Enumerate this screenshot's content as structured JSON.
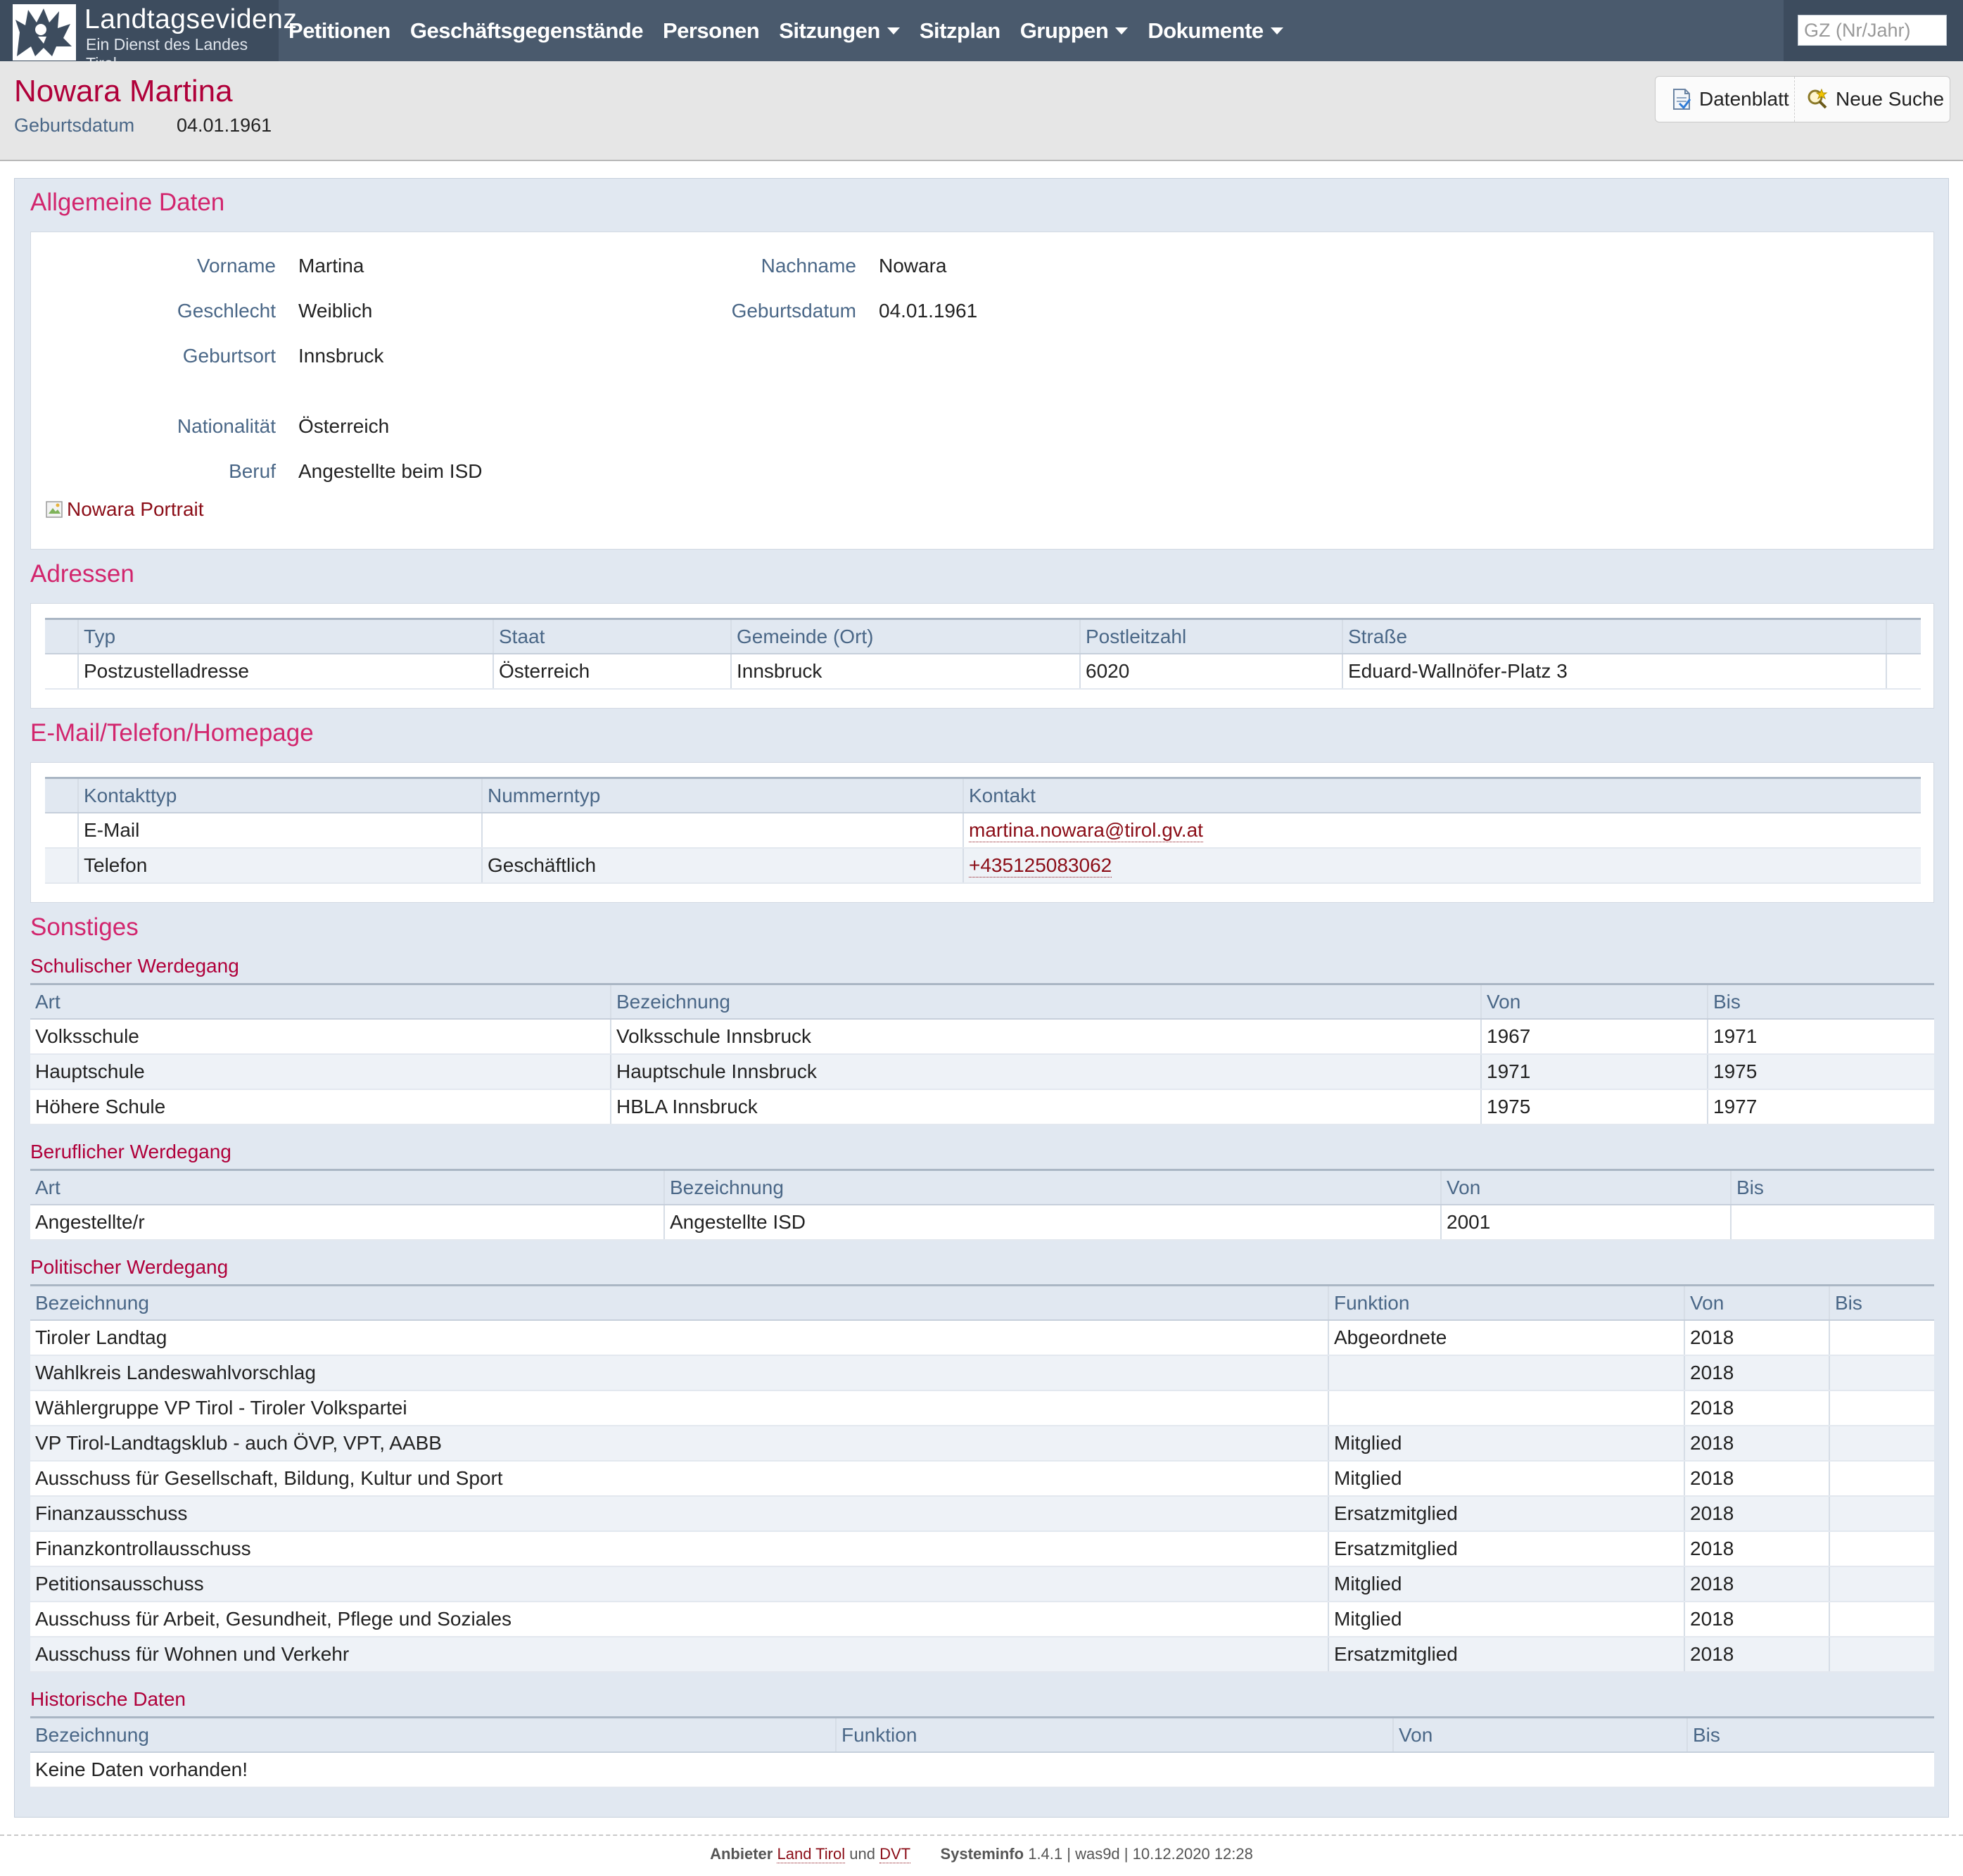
{
  "brand": {
    "title": "Landtagsevidenz",
    "subtitle": "Ein Dienst des Landes Tirol"
  },
  "nav": {
    "items": [
      "Petitionen",
      "Geschäftsgegenstände",
      "Personen",
      "Sitzungen",
      "Sitzplan",
      "Gruppen",
      "Dokumente"
    ],
    "dropdowns": [
      "Sitzungen",
      "Gruppen",
      "Dokumente"
    ],
    "search_placeholder": "GZ (Nr/Jahr)"
  },
  "header": {
    "name": "Nowara Martina",
    "birth_label": "Geburtsdatum",
    "birth_value": "04.01.1961",
    "buttons": {
      "datenblatt": "Datenblatt",
      "neue_suche": "Neue Suche"
    }
  },
  "allgemein": {
    "title": "Allgemeine Daten",
    "vorname_label": "Vorname",
    "vorname": "Martina",
    "nachname_label": "Nachname",
    "nachname": "Nowara",
    "geschlecht_label": "Geschlecht",
    "geschlecht": "Weiblich",
    "geburtsdatum_label": "Geburtsdatum",
    "geburtsdatum": "04.01.1961",
    "geburtsort_label": "Geburtsort",
    "geburtsort": "Innsbruck",
    "nationalitaet_label": "Nationalität",
    "nationalitaet": "Österreich",
    "beruf_label": "Beruf",
    "beruf": "Angestellte beim ISD",
    "portrait_alt": "Nowara Portrait"
  },
  "adressen": {
    "title": "Adressen",
    "headers": [
      "Typ",
      "Staat",
      "Gemeinde (Ort)",
      "Postleitzahl",
      "Straße"
    ],
    "rows": [
      [
        "Postzustelladresse",
        "Österreich",
        "Innsbruck",
        "6020",
        "Eduard-Wallnöfer-Platz 3"
      ]
    ]
  },
  "kontakt": {
    "title": "E-Mail/Telefon/Homepage",
    "headers": [
      "Kontakttyp",
      "Nummerntyp",
      "Kontakt"
    ],
    "rows": [
      [
        "E-Mail",
        "",
        "martina.nowara@tirol.gv.at"
      ],
      [
        "Telefon",
        "Geschäftlich",
        "+435125083062"
      ]
    ]
  },
  "sonstiges": {
    "title": "Sonstiges",
    "schulisch": {
      "title": "Schulischer Werdegang",
      "headers": [
        "Art",
        "Bezeichnung",
        "Von",
        "Bis"
      ],
      "rows": [
        [
          "Volksschule",
          "Volksschule Innsbruck",
          "1967",
          "1971"
        ],
        [
          "Hauptschule",
          "Hauptschule Innsbruck",
          "1971",
          "1975"
        ],
        [
          "Höhere Schule",
          "HBLA Innsbruck",
          "1975",
          "1977"
        ]
      ]
    },
    "beruflich": {
      "title": "Beruflicher Werdegang",
      "headers": [
        "Art",
        "Bezeichnung",
        "Von",
        "Bis"
      ],
      "rows": [
        [
          "Angestellte/r",
          "Angestellte ISD",
          "2001",
          ""
        ]
      ]
    },
    "politisch": {
      "title": "Politischer Werdegang",
      "headers": [
        "Bezeichnung",
        "Funktion",
        "Von",
        "Bis"
      ],
      "rows": [
        [
          "Tiroler Landtag",
          "Abgeordnete",
          "2018",
          ""
        ],
        [
          "Wahlkreis Landeswahlvorschlag",
          "",
          "2018",
          ""
        ],
        [
          "Wählergruppe VP Tirol - Tiroler Volkspartei",
          "",
          "2018",
          ""
        ],
        [
          "VP Tirol-Landtagsklub - auch ÖVP, VPT, AABB",
          "Mitglied",
          "2018",
          ""
        ],
        [
          "Ausschuss für Gesellschaft, Bildung, Kultur und Sport",
          "Mitglied",
          "2018",
          ""
        ],
        [
          "Finanzausschuss",
          "Ersatzmitglied",
          "2018",
          ""
        ],
        [
          "Finanzkontrollausschuss",
          "Ersatzmitglied",
          "2018",
          ""
        ],
        [
          "Petitionsausschuss",
          "Mitglied",
          "2018",
          ""
        ],
        [
          "Ausschuss für Arbeit, Gesundheit, Pflege und Soziales",
          "Mitglied",
          "2018",
          ""
        ],
        [
          "Ausschuss für Wohnen und Verkehr",
          "Ersatzmitglied",
          "2018",
          ""
        ]
      ]
    },
    "historisch": {
      "title": "Historische Daten",
      "headers": [
        "Bezeichnung",
        "Funktion",
        "Von",
        "Bis"
      ],
      "empty": "Keine Daten vorhanden!"
    }
  },
  "footer": {
    "anbieter_label": "Anbieter",
    "land": "Land Tirol",
    "und": "und",
    "dvt": "DVT",
    "systeminfo_label": "Systeminfo",
    "systeminfo": "1.4.1 | was9d | 10.12.2020 12:28"
  },
  "colors": {
    "navbar": "#4a5a6d",
    "accent": "#d2256d",
    "title": "#b0003a",
    "label": "#4a6787",
    "link": "#8b0d17"
  },
  "icons": [
    "tirol-eagle-logo",
    "datenblatt-icon",
    "neue-suche-icon",
    "broken-image-icon",
    "chevron-down-icon"
  ]
}
